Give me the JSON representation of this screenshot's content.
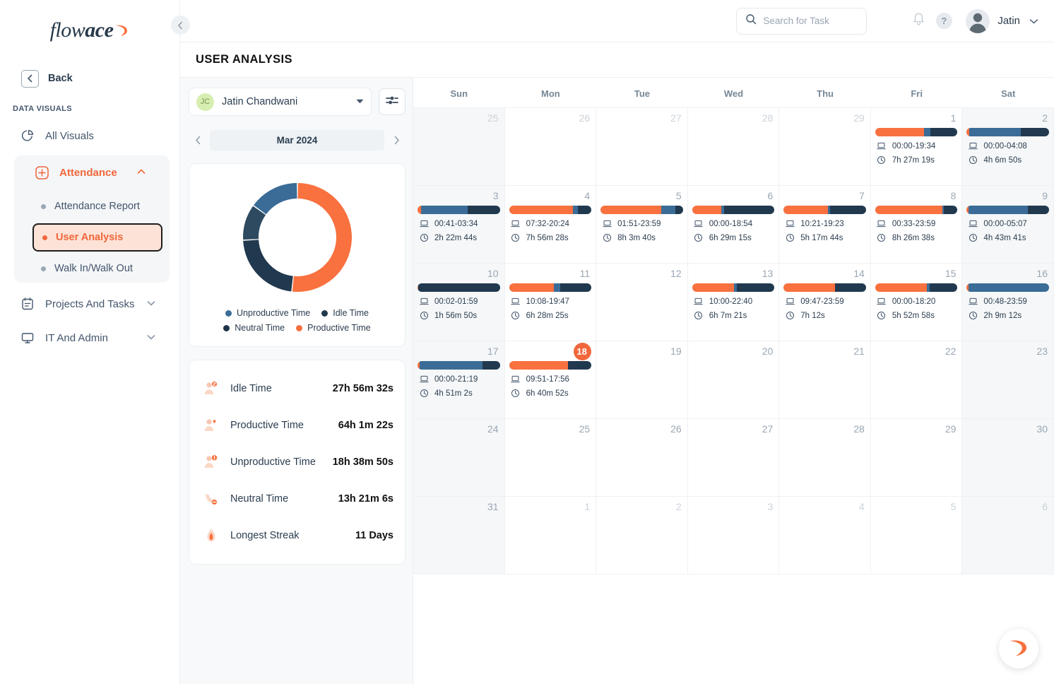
{
  "brand": {
    "name_part1": "flow",
    "name_part2": "ace",
    "accent": "#f1673c"
  },
  "sidebar": {
    "back_label": "Back",
    "section_title": "DATA VISUALS",
    "items": [
      {
        "label": "All Visuals",
        "icon": "pie-chart-icon"
      },
      {
        "label": "Attendance",
        "icon": "attendance-grid-icon"
      },
      {
        "label": "Projects And Tasks",
        "icon": "tasks-icon"
      },
      {
        "label": "IT And Admin",
        "icon": "monitor-icon"
      }
    ],
    "sub_items": [
      {
        "label": "Attendance Report",
        "selected": false
      },
      {
        "label": "User Analysis",
        "selected": true
      },
      {
        "label": "Walk In/Walk Out",
        "selected": false
      }
    ]
  },
  "topbar": {
    "search_placeholder": "Search for Task",
    "search_value": "",
    "user_name": "Jatin",
    "help_glyph": "?"
  },
  "page": {
    "title": "USER ANALYSIS"
  },
  "left_panel": {
    "user_initials": "JC",
    "user_full_name": "Jatin  Chandwani",
    "month_label": "Mar 2024",
    "legend": [
      {
        "label": "Unproductive Time",
        "color": "#3a6c97"
      },
      {
        "label": "Idle Time",
        "color": "#21394f"
      },
      {
        "label": "Neutral Time",
        "color": "#1e3347"
      },
      {
        "label": "Productive Time",
        "color": "#f8713f"
      }
    ],
    "stats": [
      {
        "label": "Idle Time",
        "value": "27h 56m 32s",
        "icon": "user-sleep-icon"
      },
      {
        "label": "Productive Time",
        "value": "64h 1m 22s",
        "icon": "user-heart-icon"
      },
      {
        "label": "Unproductive Time",
        "value": "18h 38m 50s",
        "icon": "user-alert-icon"
      },
      {
        "label": "Neutral Time",
        "value": "13h 21m 6s",
        "icon": "clock-minus-icon"
      },
      {
        "label": "Longest Streak",
        "value": "11 Days",
        "icon": "flame-icon"
      }
    ]
  },
  "chart_data": {
    "type": "pie",
    "title": "",
    "legend_position": "bottom",
    "categories": [
      "Productive Time",
      "Idle Time",
      "Neutral Time",
      "Unproductive Time"
    ],
    "values": [
      64.02,
      27.94,
      13.35,
      18.65
    ],
    "unit": "hours",
    "colors": [
      "#f8713f",
      "#21394f",
      "#2e4a60",
      "#3a6c97"
    ],
    "labels": [
      "64h 1m 22s",
      "27h 56m 32s",
      "13h 21m 6s",
      "18h 38m 50s"
    ],
    "donut": true
  },
  "calendar": {
    "weekdays": [
      "Sun",
      "Mon",
      "Tue",
      "Wed",
      "Thu",
      "Fri",
      "Sat"
    ],
    "cells": [
      {
        "day": "25",
        "other_month": true,
        "weekend": true
      },
      {
        "day": "26",
        "other_month": true,
        "weekend": false
      },
      {
        "day": "27",
        "other_month": true,
        "weekend": false
      },
      {
        "day": "28",
        "other_month": true,
        "weekend": false
      },
      {
        "day": "29",
        "other_month": true,
        "weekend": false
      },
      {
        "day": "1",
        "other_month": false,
        "weekend": false,
        "range": "00:00-19:34",
        "duration": "7h 27m 19s",
        "segments": [
          {
            "color": "#f8713f",
            "pct": 59
          },
          {
            "color": "#3a6c97",
            "pct": 8
          },
          {
            "color": "#21394f",
            "pct": 33
          }
        ]
      },
      {
        "day": "2",
        "other_month": false,
        "weekend": true,
        "range": "00:00-04:08",
        "duration": "4h 6m 50s",
        "segments": [
          {
            "color": "#f8713f",
            "pct": 3
          },
          {
            "color": "#3a6c97",
            "pct": 63
          },
          {
            "color": "#21394f",
            "pct": 34
          }
        ]
      },
      {
        "day": "3",
        "other_month": false,
        "weekend": true,
        "range": "00:41-03:34",
        "duration": "2h 22m 44s",
        "segments": [
          {
            "color": "#f8713f",
            "pct": 4
          },
          {
            "color": "#3a6c97",
            "pct": 57
          },
          {
            "color": "#21394f",
            "pct": 39
          }
        ]
      },
      {
        "day": "4",
        "other_month": false,
        "weekend": false,
        "range": "07:32-20:24",
        "duration": "7h 56m 28s",
        "segments": [
          {
            "color": "#f8713f",
            "pct": 78
          },
          {
            "color": "#3a6c97",
            "pct": 6
          },
          {
            "color": "#21394f",
            "pct": 16
          }
        ]
      },
      {
        "day": "5",
        "other_month": false,
        "weekend": false,
        "range": "01:51-23:59",
        "duration": "8h 3m 40s",
        "segments": [
          {
            "color": "#f8713f",
            "pct": 74
          },
          {
            "color": "#3a6c97",
            "pct": 17
          },
          {
            "color": "#21394f",
            "pct": 9
          }
        ]
      },
      {
        "day": "6",
        "other_month": false,
        "weekend": false,
        "range": "00:00-18:54",
        "duration": "6h 29m 15s",
        "segments": [
          {
            "color": "#f8713f",
            "pct": 35
          },
          {
            "color": "#3a6c97",
            "pct": 4
          },
          {
            "color": "#21394f",
            "pct": 61
          }
        ]
      },
      {
        "day": "7",
        "other_month": false,
        "weekend": false,
        "range": "10:21-19:23",
        "duration": "5h 17m 44s",
        "segments": [
          {
            "color": "#f8713f",
            "pct": 54
          },
          {
            "color": "#3a6c97",
            "pct": 2
          },
          {
            "color": "#21394f",
            "pct": 44
          }
        ]
      },
      {
        "day": "8",
        "other_month": false,
        "weekend": false,
        "range": "00:33-23:59",
        "duration": "8h 26m 38s",
        "segments": [
          {
            "color": "#f8713f",
            "pct": 82
          },
          {
            "color": "#3a6c97",
            "pct": 1
          },
          {
            "color": "#21394f",
            "pct": 17
          }
        ]
      },
      {
        "day": "9",
        "other_month": false,
        "weekend": true,
        "range": "00:00-05:07",
        "duration": "4h 43m 41s",
        "segments": [
          {
            "color": "#f8713f",
            "pct": 2
          },
          {
            "color": "#3a6c97",
            "pct": 72
          },
          {
            "color": "#21394f",
            "pct": 26
          }
        ]
      },
      {
        "day": "10",
        "other_month": false,
        "weekend": true,
        "range": "00:02-01:59",
        "duration": "1h 56m 50s",
        "segments": [
          {
            "color": "#f8713f",
            "pct": 1
          },
          {
            "color": "#21394f",
            "pct": 99
          }
        ]
      },
      {
        "day": "11",
        "other_month": false,
        "weekend": false,
        "range": "10:08-19:47",
        "duration": "6h 28m 25s",
        "segments": [
          {
            "color": "#f8713f",
            "pct": 54
          },
          {
            "color": "#3a6c97",
            "pct": 8
          },
          {
            "color": "#21394f",
            "pct": 38
          }
        ]
      },
      {
        "day": "12",
        "other_month": false,
        "weekend": false
      },
      {
        "day": "13",
        "other_month": false,
        "weekend": false,
        "range": "10:00-22:40",
        "duration": "6h 7m 21s",
        "segments": [
          {
            "color": "#f8713f",
            "pct": 51
          },
          {
            "color": "#3a6c97",
            "pct": 3
          },
          {
            "color": "#21394f",
            "pct": 46
          }
        ]
      },
      {
        "day": "14",
        "other_month": false,
        "weekend": false,
        "range": "09:47-23:59",
        "duration": "7h 12s",
        "segments": [
          {
            "color": "#f8713f",
            "pct": 62
          },
          {
            "color": "#21394f",
            "pct": 38
          }
        ]
      },
      {
        "day": "15",
        "other_month": false,
        "weekend": false,
        "range": "00:00-18:20",
        "duration": "5h 52m 58s",
        "segments": [
          {
            "color": "#f8713f",
            "pct": 63
          },
          {
            "color": "#3a6c97",
            "pct": 3
          },
          {
            "color": "#21394f",
            "pct": 34
          }
        ]
      },
      {
        "day": "16",
        "other_month": false,
        "weekend": true,
        "range": "00:48-23:59",
        "duration": "2h 9m 12s",
        "segments": [
          {
            "color": "#f8713f",
            "pct": 2
          },
          {
            "color": "#3a6c97",
            "pct": 98
          }
        ]
      },
      {
        "day": "17",
        "other_month": false,
        "weekend": true,
        "range": "00:00-21:19",
        "duration": "4h 51m 2s",
        "segments": [
          {
            "color": "#f8713f",
            "pct": 3
          },
          {
            "color": "#3a6c97",
            "pct": 76
          },
          {
            "color": "#21394f",
            "pct": 21
          }
        ]
      },
      {
        "day": "18",
        "other_month": false,
        "weekend": false,
        "today": true,
        "range": "09:51-17:56",
        "duration": "6h 40m 52s",
        "segments": [
          {
            "color": "#f8713f",
            "pct": 72
          },
          {
            "color": "#21394f",
            "pct": 28
          }
        ]
      },
      {
        "day": "19",
        "other_month": false,
        "weekend": false
      },
      {
        "day": "20",
        "other_month": false,
        "weekend": false
      },
      {
        "day": "21",
        "other_month": false,
        "weekend": false
      },
      {
        "day": "22",
        "other_month": false,
        "weekend": false
      },
      {
        "day": "23",
        "other_month": false,
        "weekend": true
      },
      {
        "day": "24",
        "other_month": false,
        "weekend": true
      },
      {
        "day": "25",
        "other_month": false,
        "weekend": false
      },
      {
        "day": "26",
        "other_month": false,
        "weekend": false
      },
      {
        "day": "27",
        "other_month": false,
        "weekend": false
      },
      {
        "day": "28",
        "other_month": false,
        "weekend": false
      },
      {
        "day": "29",
        "other_month": false,
        "weekend": false
      },
      {
        "day": "30",
        "other_month": false,
        "weekend": true
      },
      {
        "day": "31",
        "other_month": false,
        "weekend": true
      },
      {
        "day": "1",
        "other_month": true,
        "weekend": false
      },
      {
        "day": "2",
        "other_month": true,
        "weekend": false
      },
      {
        "day": "3",
        "other_month": true,
        "weekend": false
      },
      {
        "day": "4",
        "other_month": true,
        "weekend": false
      },
      {
        "day": "5",
        "other_month": true,
        "weekend": false
      },
      {
        "day": "6",
        "other_month": true,
        "weekend": true
      }
    ]
  }
}
